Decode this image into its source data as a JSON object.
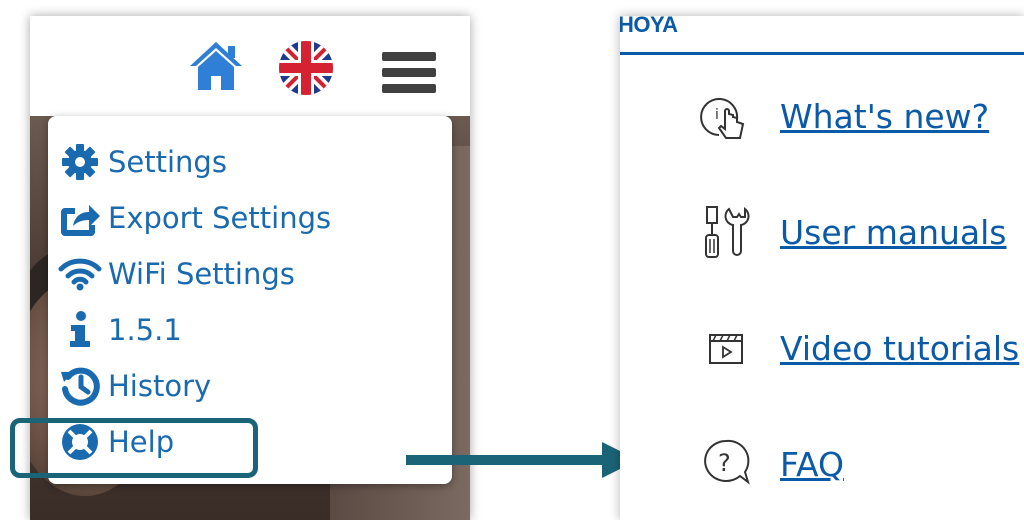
{
  "left_app": {
    "header": {
      "icons": [
        "home-icon",
        "uk-flag-icon",
        "hamburger-menu-icon"
      ]
    },
    "menu": {
      "items": [
        {
          "label": "Settings",
          "icon": "gear-icon"
        },
        {
          "label": "Export Settings",
          "icon": "share-export-icon"
        },
        {
          "label": "WiFi Settings",
          "icon": "wifi-icon"
        },
        {
          "label": "1.5.1",
          "icon": "info-icon"
        },
        {
          "label": "History",
          "icon": "history-icon"
        },
        {
          "label": "Help",
          "icon": "lifebuoy-icon"
        }
      ],
      "highlighted_item": "Help"
    }
  },
  "right_app": {
    "logo": "HOYA",
    "links": [
      {
        "label": "What's new?",
        "icon": "touch-info-icon"
      },
      {
        "label": "User manuals",
        "icon": "tools-icon"
      },
      {
        "label": "Video tutorials",
        "icon": "video-clapper-icon"
      },
      {
        "label": "FAQ",
        "icon": "question-bubble-icon"
      }
    ]
  },
  "colors": {
    "menu_text": "#1a6ab0",
    "link_text": "#0b5aa8",
    "highlight_border": "#1b6478",
    "arrow": "#1b6478",
    "home_icon": "#2f7fd6"
  }
}
